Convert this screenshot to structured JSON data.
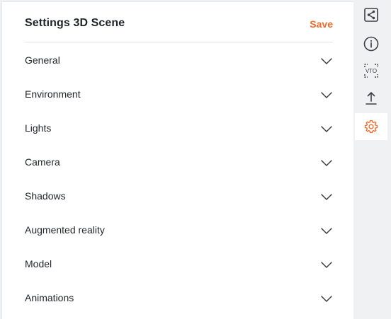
{
  "panel": {
    "title": "Settings 3D Scene",
    "save_label": "Save"
  },
  "sections": [
    {
      "label": "General"
    },
    {
      "label": "Environment"
    },
    {
      "label": "Lights"
    },
    {
      "label": "Camera"
    },
    {
      "label": "Shadows"
    },
    {
      "label": "Augmented reality"
    },
    {
      "label": "Model"
    },
    {
      "label": "Animations"
    }
  ],
  "rail": {
    "items": [
      {
        "icon": "share-icon",
        "active": false
      },
      {
        "icon": "info-icon",
        "active": false
      },
      {
        "icon": "vto-icon",
        "label": "VTO",
        "active": false
      },
      {
        "icon": "upload-icon",
        "active": false
      },
      {
        "icon": "gear-icon",
        "active": true
      }
    ]
  },
  "colors": {
    "accent": "#f26b2a",
    "text": "#1f2328",
    "icon": "#3a3f45",
    "rail_bg": "#f0f1f3"
  }
}
